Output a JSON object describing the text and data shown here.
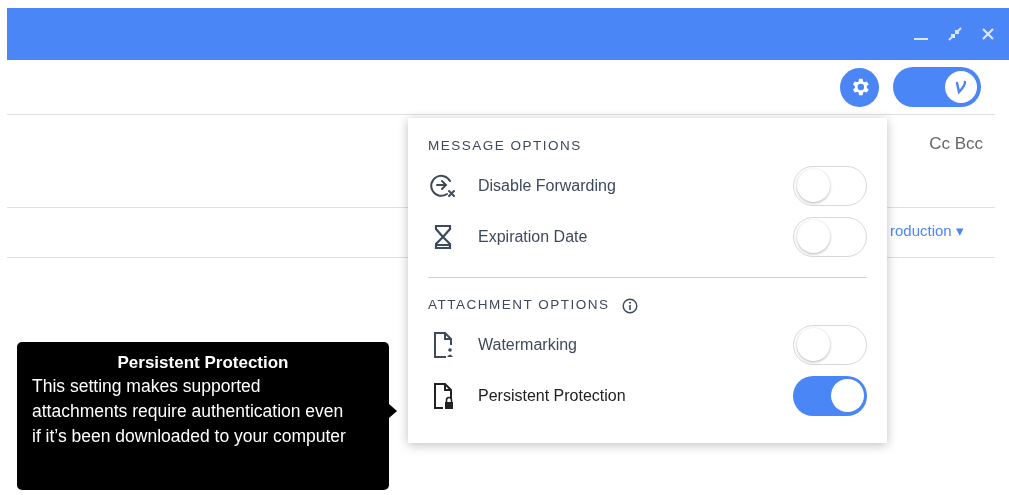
{
  "compose": {
    "recipients_links": "Cc Bcc",
    "template_link": "roduction ▾",
    "toolbar_toggle": {
      "on": true
    }
  },
  "options_menu": {
    "sections": [
      {
        "title": "MESSAGE OPTIONS",
        "has_info": false,
        "items": [
          {
            "label": "Disable Forwarding",
            "on": false
          },
          {
            "label": "Expiration Date",
            "on": false
          }
        ]
      },
      {
        "title": "ATTACHMENT OPTIONS",
        "has_info": true,
        "items": [
          {
            "label": "Watermarking",
            "on": false
          },
          {
            "label": "Persistent Protection",
            "on": true
          }
        ]
      }
    ]
  },
  "tooltip": {
    "title": "Persistent Protection",
    "text": "This setting makes supported attachments require authentication even if it’s been downloaded to your computer"
  }
}
